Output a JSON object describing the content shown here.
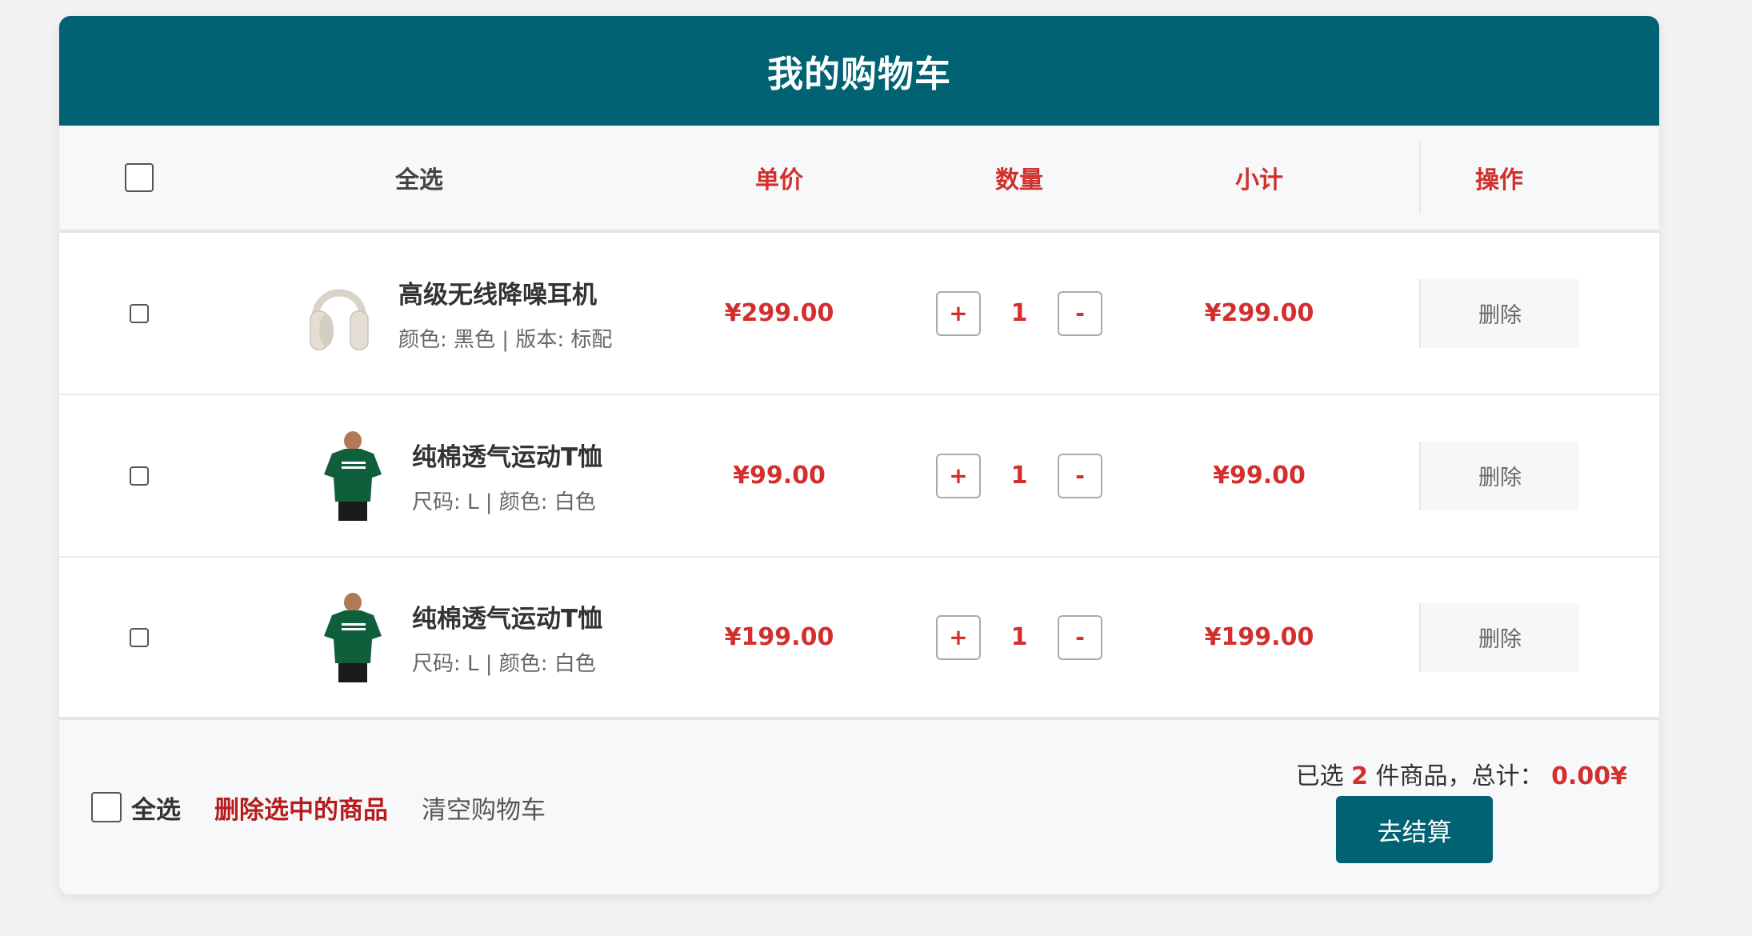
{
  "header": {
    "title": "我的购物车"
  },
  "columns": {
    "select_all": "全选",
    "price": "单价",
    "quantity": "数量",
    "subtotal": "小计",
    "action": "操作"
  },
  "items": [
    {
      "name": "高级无线降噪耳机",
      "attrs": "颜色: 黑色 | 版本: 标配",
      "price": "¥299.00",
      "qty": "1",
      "subtotal": "¥299.00",
      "delete": "删除",
      "image": "headphones"
    },
    {
      "name": "纯棉透气运动T恤",
      "attrs": "尺码: L | 颜色: 白色",
      "price": "¥99.00",
      "qty": "1",
      "subtotal": "¥99.00",
      "delete": "删除",
      "image": "green-tshirt"
    },
    {
      "name": "纯棉透气运动T恤",
      "attrs": "尺码: L | 颜色: 白色",
      "price": "¥199.00",
      "qty": "1",
      "subtotal": "¥199.00",
      "delete": "删除",
      "image": "green-tshirt"
    }
  ],
  "qty_controls": {
    "plus": "+",
    "minus": "-"
  },
  "footer": {
    "select_all": "全选",
    "delete_selected": "删除选中的商品",
    "clear_cart": "清空购物车",
    "summary_prefix": "已选",
    "selected_count": "2",
    "summary_middle": "件商品，总计：",
    "total": "0.00¥",
    "checkout": "去结算"
  },
  "colors": {
    "brand": "#006272",
    "price_red": "#d32f2f",
    "danger": "#b71c1c"
  }
}
